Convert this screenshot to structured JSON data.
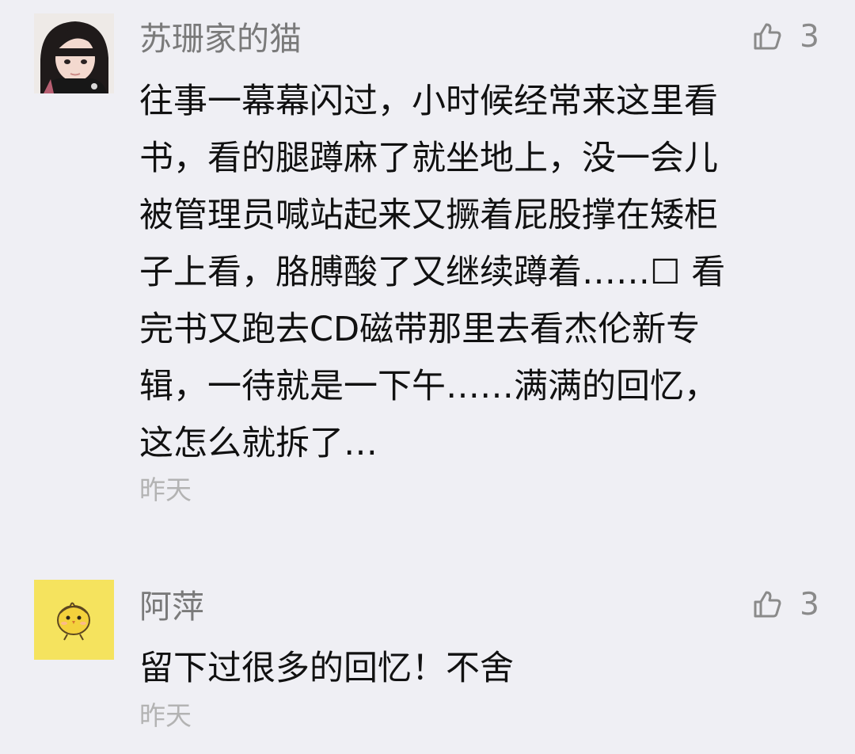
{
  "comments": [
    {
      "author": "苏珊家的猫",
      "likes": "3",
      "content": "往事一幕幕闪过，小时候经常来这里看\n书，看的腿蹲麻了就坐地上，没一会儿\n被管理员喊站起来又撅着屁股撑在矮柜\n子上看，胳膊酸了又继续蹲着……☐ 看\n完书又跑去CD磁带那里去看杰伦新专\n辑，一待就是一下午……满满的回忆，\n这怎么就拆了…",
      "time": "昨天",
      "avatar_icon": "girl-portrait-avatar",
      "like_icon": "thumbs-up-icon"
    },
    {
      "author": "阿萍",
      "likes": "3",
      "content": "留下过很多的回忆！不舍",
      "time": "昨天",
      "avatar_icon": "yellow-chick-avatar",
      "like_icon": "thumbs-up-icon"
    }
  ],
  "colors": {
    "background": "#efeff4",
    "author": "#7a7a7a",
    "content": "#111111",
    "time": "#b3b3b3",
    "like": "#8a8a8a",
    "avatar2_bg": "#f5e35e"
  }
}
